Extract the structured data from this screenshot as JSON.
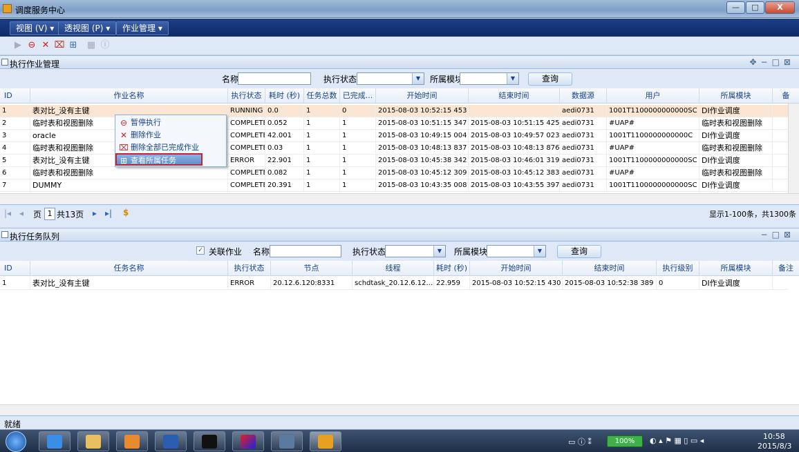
{
  "window": {
    "title": "调度服务中心",
    "btn_min": "—",
    "btn_max": "□",
    "btn_close": "X"
  },
  "menu": {
    "view": "视图 (V) ▾",
    "perspective": "透视图 (P) ▾",
    "job_mgmt": "作业管理 ▾"
  },
  "job_panel": {
    "title": "执行作业管理",
    "filter": {
      "name_label": "名称",
      "status_label": "执行状态",
      "module_label": "所属模块",
      "query_button": "查询"
    },
    "columns": [
      "ID",
      "作业名称",
      "执行状态",
      "耗时 (秒)",
      "任务总数",
      "已完成...",
      "开始时间",
      "结束时间",
      "数据源",
      "用户",
      "所属模块",
      "备"
    ],
    "rows": [
      [
        "1",
        "表对比_没有主键",
        "RUNNING",
        "0.0",
        "1",
        "0",
        "2015-08-03 10:52:15 453",
        "",
        "aedi0731",
        "1001T1100000000000SC",
        "DI作业调度"
      ],
      [
        "2",
        "临时表和视图删除",
        "COMPLETE",
        "0.052",
        "1",
        "1",
        "2015-08-03 10:51:15 347",
        "2015-08-03 10:51:15 425",
        "aedi0731",
        "#UAP#",
        "临时表和视图删除"
      ],
      [
        "3",
        "oracle",
        "COMPLETE",
        "42.001",
        "1",
        "1",
        "2015-08-03 10:49:15 004",
        "2015-08-03 10:49:57 023",
        "aedi0731",
        "1001T1100000000000C",
        "DI作业调度"
      ],
      [
        "4",
        "临时表和视图删除",
        "COMPLETE",
        "0.03",
        "1",
        "1",
        "2015-08-03 10:48:13 837",
        "2015-08-03 10:48:13 876",
        "aedi0731",
        "#UAP#",
        "临时表和视图删除"
      ],
      [
        "5",
        "表对比_没有主键",
        "ERROR",
        "22.901",
        "1",
        "1",
        "2015-08-03 10:45:38 342",
        "2015-08-03 10:46:01 319",
        "aedi0731",
        "1001T1100000000000SC",
        "DI作业调度"
      ],
      [
        "6",
        "临时表和视图删除",
        "COMPLETE",
        "0.082",
        "1",
        "1",
        "2015-08-03 10:45:12 309",
        "2015-08-03 10:45:12 383",
        "aedi0731",
        "#UAP#",
        "临时表和视图删除"
      ],
      [
        "7",
        "DUMMY",
        "COMPLETE",
        "20.391",
        "1",
        "1",
        "2015-08-03 10:43:35 008",
        "2015-08-03 10:43:55 397",
        "aedi0731",
        "1001T1100000000000SC",
        "DI作业调度"
      ]
    ],
    "pager": {
      "page_label": "页",
      "page": "1",
      "total": "共13页",
      "summary": "显示1-100条，共1300条"
    }
  },
  "context_menu": {
    "items": [
      {
        "label": "暂停执行",
        "icon": "stop-icon"
      },
      {
        "label": "删除作业",
        "icon": "delete-icon"
      },
      {
        "label": "删除全部已完成作业",
        "icon": "delete-all-icon"
      },
      {
        "label": "查看所属任务",
        "icon": "view-task-icon"
      }
    ]
  },
  "task_panel": {
    "title": "执行任务队列",
    "filter": {
      "link_label": "关联作业",
      "name_label": "名称",
      "status_label": "执行状态",
      "module_label": "所属模块",
      "query_button": "查询"
    },
    "columns": [
      "ID",
      "任务名称",
      "执行状态",
      "节点",
      "线程",
      "耗时 (秒)",
      "开始时间",
      "结束时间",
      "执行级别",
      "所属模块",
      "备注"
    ],
    "rows": [
      [
        "1",
        "表对比_没有主键",
        "ERROR",
        "20.12.6.120:8331",
        "schdtask_20.12.6.12...",
        "22.959",
        "2015-08-03 10:52:15 430",
        "2015-08-03 10:52:38 389",
        "0",
        "DI作业调度"
      ]
    ]
  },
  "status_bar": {
    "text": "就绪"
  },
  "taskbar": {
    "battery": "100%",
    "time": "10:58",
    "date": "2015/8/3"
  },
  "colors": {
    "menubar": "#1c3f86",
    "selected_row": "#fbe6d4",
    "highlight_border": "#c8232a"
  }
}
